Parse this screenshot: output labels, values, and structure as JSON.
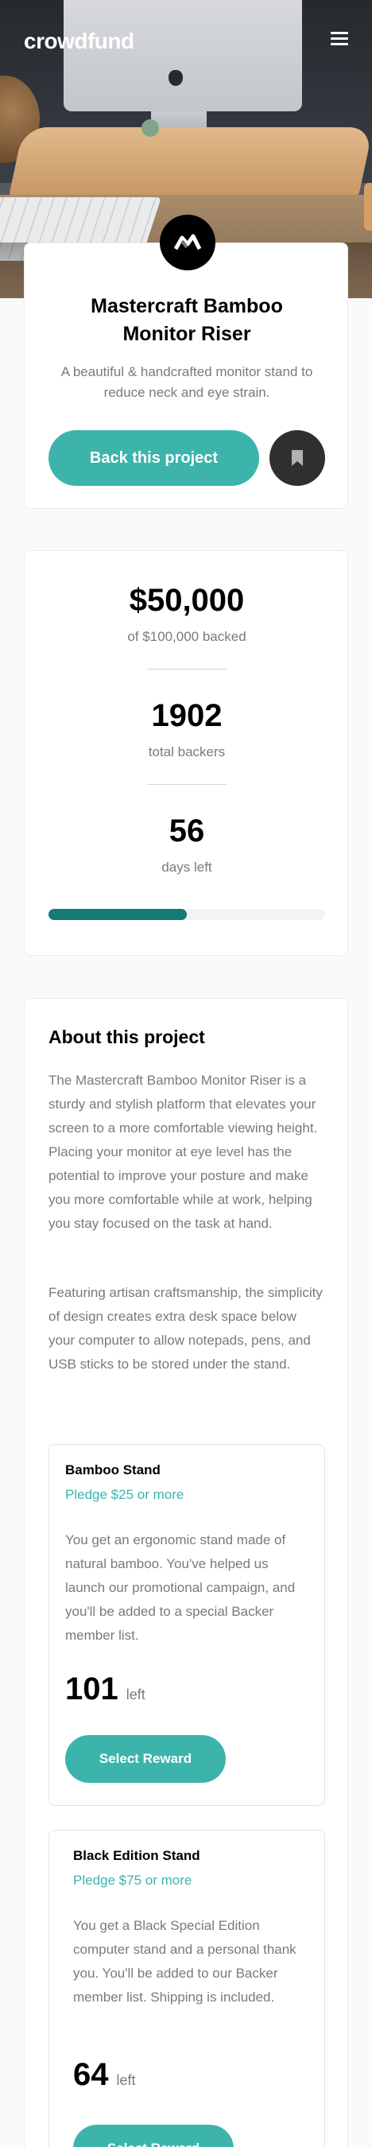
{
  "header": {
    "logo": "crowdfund"
  },
  "intro": {
    "title": "Mastercraft Bamboo Monitor Riser",
    "description": "A beautiful & handcrafted monitor stand to reduce neck and eye strain.",
    "back_label": "Back this project"
  },
  "stats": {
    "backed_amount": "$50,000",
    "backed_label": "of $100,000 backed",
    "backers": "1902",
    "backers_label": "total backers",
    "days": "56",
    "days_label": "days left",
    "progress_fraction": 0.5
  },
  "about": {
    "title": "About this project",
    "p1": "The Mastercraft Bamboo Monitor Riser is a sturdy and stylish platform that elevates your screen to a more comfortable viewing height. Placing your monitor at eye level has the potential to improve your posture and make you more comfortable while at work, helping you stay focused on the task at hand.",
    "p2": "Featuring artisan craftsmanship, the simplicity of design creates extra desk space below your computer to allow notepads, pens, and USB sticks to be stored under the stand.",
    "rewards": [
      {
        "name": "Bamboo Stand",
        "pledge": "Pledge $25 or more",
        "description": "You get an ergonomic stand made of natural bamboo. You've helped us launch our promotional campaign, and you'll be added to a special Backer member list.",
        "left": "101",
        "left_label": "left",
        "button": "Select Reward"
      },
      {
        "name": "Black Edition Stand",
        "pledge": "Pledge $75 or more",
        "description": "You get a Black Special Edition computer stand and a personal thank you. You'll be added to our Backer member list. Shipping is included.",
        "left": "64",
        "left_label": "left",
        "button": "Select Reward"
      }
    ]
  },
  "icons": {
    "menu": "hamburger-icon",
    "bookmark": "bookmark-icon",
    "brand": "mastercraft-logo"
  },
  "colors": {
    "accent": "#3cb4ac",
    "accent_dark": "#157a74",
    "text_muted": "#7a7a7a"
  }
}
